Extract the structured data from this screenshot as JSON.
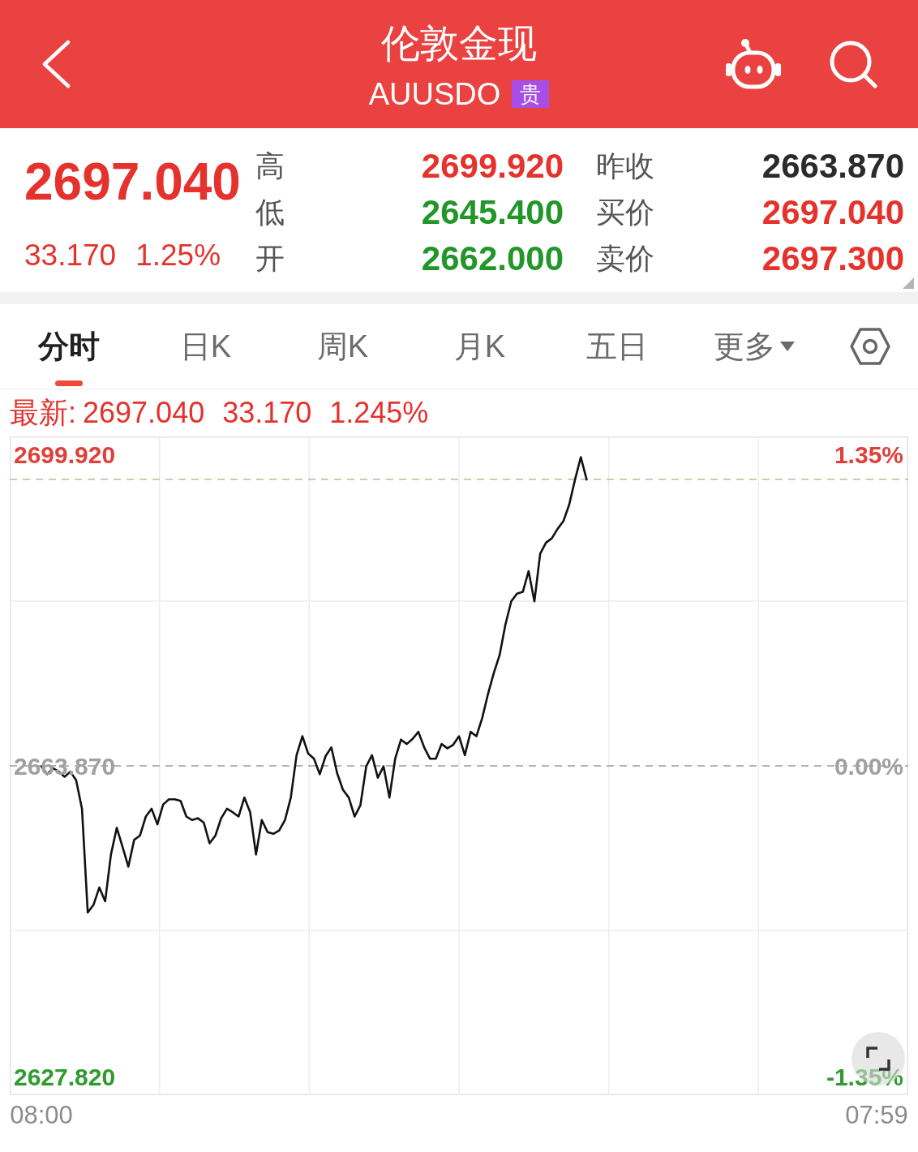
{
  "header": {
    "title": "伦敦金现",
    "code": "AUUSDO",
    "badge": "贵"
  },
  "quote": {
    "price": "2697.040",
    "change": "33.170",
    "change_pct": "1.25%",
    "rows": [
      {
        "left": {
          "label": "高",
          "value": "2699.920",
          "color": "#e5322d"
        },
        "right": {
          "label": "昨收",
          "value": "2663.870",
          "color": "#2b2b2b"
        }
      },
      {
        "left": {
          "label": "低",
          "value": "2645.400",
          "color": "#23962a"
        },
        "right": {
          "label": "买价",
          "value": "2697.040",
          "color": "#e5322d"
        }
      },
      {
        "left": {
          "label": "开",
          "value": "2662.000",
          "color": "#23962a"
        },
        "right": {
          "label": "卖价",
          "value": "2697.300",
          "color": "#e5322d"
        }
      }
    ]
  },
  "tabs": [
    {
      "label": "分时",
      "selected": true,
      "has_menu": false
    },
    {
      "label": "日K",
      "selected": false,
      "has_menu": false
    },
    {
      "label": "周K",
      "selected": false,
      "has_menu": false
    },
    {
      "label": "月K",
      "selected": false,
      "has_menu": false
    },
    {
      "label": "五日",
      "selected": false,
      "has_menu": false
    },
    {
      "label": "更多",
      "selected": false,
      "has_menu": true
    }
  ],
  "latest": {
    "label": "最新:",
    "price": "2697.040",
    "change": "33.170",
    "change_pct": "1.245%"
  },
  "chart": {
    "percent_ticks": [
      {
        "label": "1.35%",
        "color": "#e0403a"
      },
      {
        "label": "0.00%",
        "color": "#a0a0a0"
      },
      {
        "label": "-1.35%",
        "color": "#2d9b2d"
      }
    ],
    "chart_data": {
      "type": "line",
      "ylim": [
        2625.75,
        2701.99
      ],
      "yticks": [
        {
          "value": 2627.82,
          "label": "2627.820"
        },
        {
          "value": 2663.87,
          "label": "2663.870"
        },
        {
          "value": 2699.92,
          "label": "2699.920"
        }
      ],
      "categories": [
        "08:00",
        null,
        null,
        null,
        null,
        null,
        null,
        null,
        null,
        null,
        null,
        null,
        null,
        null,
        null,
        null,
        null,
        null,
        null,
        null,
        null,
        null,
        null,
        null,
        null,
        null,
        null,
        null,
        null,
        null,
        null,
        null,
        null,
        null,
        null,
        null,
        null,
        null,
        null,
        null,
        null,
        null,
        null,
        null,
        null,
        null,
        null,
        null,
        null,
        null,
        null,
        null,
        null,
        null,
        null,
        null,
        null,
        null,
        null,
        null,
        null,
        null,
        null,
        null,
        null,
        null,
        null,
        null,
        null,
        null,
        null,
        null,
        null,
        null,
        null,
        null,
        null,
        null,
        null,
        null,
        null,
        null,
        null,
        null,
        null,
        null,
        null,
        null,
        null,
        null,
        null,
        null,
        null,
        null,
        null,
        null,
        null,
        null,
        null,
        null,
        null,
        null,
        null,
        null,
        null,
        null,
        null,
        null,
        null,
        null,
        null,
        null,
        null,
        null,
        null,
        null,
        null,
        null,
        null,
        null,
        null,
        null,
        null,
        null,
        null,
        null,
        null,
        null,
        null,
        null,
        null,
        null,
        null,
        null,
        null,
        null,
        null,
        null,
        null,
        null,
        null,
        null,
        null,
        null,
        "07:59"
      ],
      "series": [
        {
          "color": "#111111",
          "values": [
            2663.8,
            2662.9,
            2663.6,
            2663.2,
            2662.6,
            2663.2,
            2662.2,
            2658.9,
            2646.9,
            2647.8,
            2649.8,
            2648.2,
            2653.6,
            2656.7,
            2654.5,
            2652.2,
            2655.3,
            2655.8,
            2658.0,
            2658.9,
            2657.1,
            2659.4,
            2660.0,
            2660.0,
            2659.8,
            2658.0,
            2657.6,
            2657.8,
            2657.3,
            2654.9,
            2655.8,
            2657.8,
            2658.9,
            2658.5,
            2658.0,
            2660.2,
            2658.5,
            2653.6,
            2657.6,
            2656.2,
            2656.0,
            2656.4,
            2657.6,
            2660.2,
            2665.1,
            2667.3,
            2665.3,
            2664.7,
            2662.9,
            2665.0,
            2666.0,
            2663.0,
            2661.1,
            2660.2,
            2658.0,
            2659.3,
            2663.8,
            2665.1,
            2662.5,
            2663.8,
            2660.2,
            2664.7,
            2666.9,
            2666.4,
            2667.0,
            2667.8,
            2666.0,
            2664.7,
            2664.7,
            2666.4,
            2665.9,
            2666.3,
            2667.3,
            2665.1,
            2667.8,
            2667.3,
            2669.4,
            2672.2,
            2674.6,
            2676.7,
            2680.2,
            2682.9,
            2683.8,
            2684.0,
            2686.4,
            2682.9,
            2688.4,
            2689.7,
            2690.2,
            2691.3,
            2692.2,
            2694.1,
            2697.0,
            2699.6,
            2697.0,
            null,
            null,
            null,
            null,
            null,
            null,
            null,
            null,
            null,
            null,
            null,
            null,
            null,
            null,
            null,
            null,
            null,
            null,
            null,
            null,
            null,
            null,
            null,
            null,
            null,
            null,
            null,
            null,
            null,
            null,
            null,
            null,
            null,
            null,
            null,
            null,
            null,
            null,
            null,
            null,
            null,
            null,
            null,
            null,
            null,
            null,
            null,
            null,
            null,
            null
          ]
        }
      ],
      "ref_lines": [
        {
          "axis": "y",
          "value": 2697.04,
          "color": "#a9c48b"
        },
        {
          "axis": "y",
          "value": 2663.87,
          "color": "#9a9a9a"
        }
      ]
    }
  }
}
